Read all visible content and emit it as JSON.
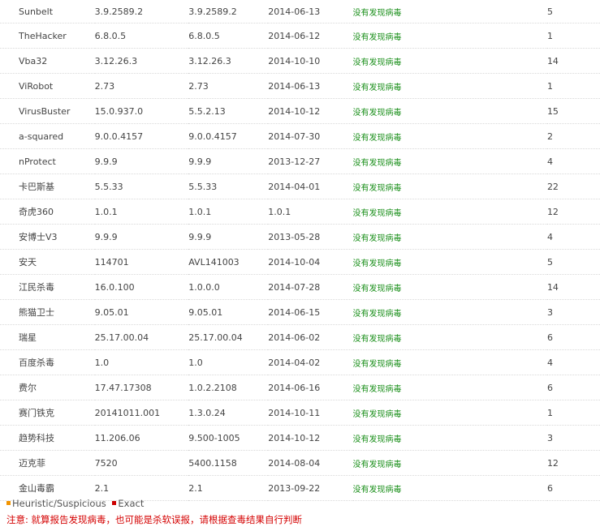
{
  "scan_results": {
    "rows": [
      {
        "engine": "Sunbelt",
        "version": "3.9.2589.2",
        "signature": "3.9.2589.2",
        "date": "2014-06-13",
        "result": "没有发现病毒",
        "time": "5"
      },
      {
        "engine": "TheHacker",
        "version": "6.8.0.5",
        "signature": "6.8.0.5",
        "date": "2014-06-12",
        "result": "没有发现病毒",
        "time": "1"
      },
      {
        "engine": "Vba32",
        "version": "3.12.26.3",
        "signature": "3.12.26.3",
        "date": "2014-10-10",
        "result": "没有发现病毒",
        "time": "14"
      },
      {
        "engine": "ViRobot",
        "version": "2.73",
        "signature": "2.73",
        "date": "2014-06-13",
        "result": "没有发现病毒",
        "time": "1"
      },
      {
        "engine": "VirusBuster",
        "version": "15.0.937.0",
        "signature": "5.5.2.13",
        "date": "2014-10-12",
        "result": "没有发现病毒",
        "time": "15"
      },
      {
        "engine": "a-squared",
        "version": "9.0.0.4157",
        "signature": "9.0.0.4157",
        "date": "2014-07-30",
        "result": "没有发现病毒",
        "time": "2"
      },
      {
        "engine": "nProtect",
        "version": "9.9.9",
        "signature": "9.9.9",
        "date": "2013-12-27",
        "result": "没有发现病毒",
        "time": "4"
      },
      {
        "engine": "卡巴斯基",
        "version": "5.5.33",
        "signature": "5.5.33",
        "date": "2014-04-01",
        "result": "没有发现病毒",
        "time": "22"
      },
      {
        "engine": "奇虎360",
        "version": "1.0.1",
        "signature": "1.0.1",
        "date": "1.0.1",
        "result": "没有发现病毒",
        "time": "12"
      },
      {
        "engine": "安博士V3",
        "version": "9.9.9",
        "signature": "9.9.9",
        "date": "2013-05-28",
        "result": "没有发现病毒",
        "time": "4"
      },
      {
        "engine": "安天",
        "version": "114701",
        "signature": "AVL141003",
        "date": "2014-10-04",
        "result": "没有发现病毒",
        "time": "5"
      },
      {
        "engine": "江民杀毒",
        "version": "16.0.100",
        "signature": "1.0.0.0",
        "date": "2014-07-28",
        "result": "没有发现病毒",
        "time": "14"
      },
      {
        "engine": "熊猫卫士",
        "version": "9.05.01",
        "signature": "9.05.01",
        "date": "2014-06-15",
        "result": "没有发现病毒",
        "time": "3"
      },
      {
        "engine": "瑞星",
        "version": "25.17.00.04",
        "signature": "25.17.00.04",
        "date": "2014-06-02",
        "result": "没有发现病毒",
        "time": "6"
      },
      {
        "engine": "百度杀毒",
        "version": "1.0",
        "signature": "1.0",
        "date": "2014-04-02",
        "result": "没有发现病毒",
        "time": "4"
      },
      {
        "engine": "费尔",
        "version": "17.47.17308",
        "signature": "1.0.2.2108",
        "date": "2014-06-16",
        "result": "没有发现病毒",
        "time": "6"
      },
      {
        "engine": "赛门铁克",
        "version": "20141011.001",
        "signature": "1.3.0.24",
        "date": "2014-10-11",
        "result": "没有发现病毒",
        "time": "1"
      },
      {
        "engine": "趋势科技",
        "version": "11.206.06",
        "signature": "9.500-1005",
        "date": "2014-10-12",
        "result": "没有发现病毒",
        "time": "3"
      },
      {
        "engine": "迈克菲",
        "version": "7520",
        "signature": "5400.1158",
        "date": "2014-08-04",
        "result": "没有发现病毒",
        "time": "12"
      },
      {
        "engine": "金山毒霸",
        "version": "2.1",
        "signature": "2.1",
        "date": "2013-09-22",
        "result": "没有发现病毒",
        "time": "6"
      }
    ]
  },
  "legend": {
    "heuristic_label": "Heuristic/Suspicious",
    "heuristic_color": "#f29400",
    "exact_label": "Exact",
    "exact_color": "#cc0000"
  },
  "notice": {
    "text": "注意: 就算报告发现病毒，也可能是杀软误报，请根据查毒结果自行判断"
  },
  "colors": {
    "clean_result": "#1a8f1a",
    "notice": "#d40000"
  }
}
